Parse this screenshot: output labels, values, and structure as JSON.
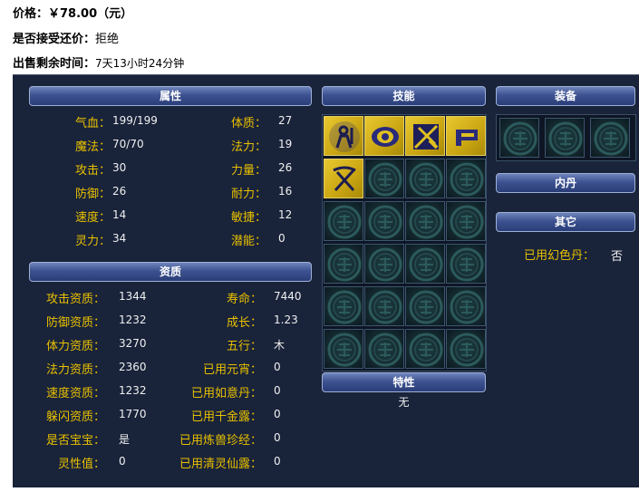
{
  "header": {
    "price_label": "价格：",
    "price_value": "￥78.00（元）",
    "bargain_label": "是否接受还价：",
    "bargain_value": "拒绝",
    "time_label": "出售剩余时间：",
    "time_value": "7天13小时24分钟"
  },
  "sections": {
    "attributes": "属性",
    "skills": "技能",
    "equipment": "装备",
    "aptitude": "资质",
    "neidan": "内丹",
    "other": "其它",
    "trait": "特性"
  },
  "attributes_left": [
    {
      "label": "气血：",
      "value": "199/199"
    },
    {
      "label": "魔法：",
      "value": "70/70"
    },
    {
      "label": "攻击：",
      "value": "30"
    },
    {
      "label": "防御：",
      "value": "26"
    },
    {
      "label": "速度：",
      "value": "14"
    },
    {
      "label": "灵力：",
      "value": "34"
    }
  ],
  "attributes_right": [
    {
      "label": "体质：",
      "value": "27"
    },
    {
      "label": "法力：",
      "value": "19"
    },
    {
      "label": "力量：",
      "value": "26"
    },
    {
      "label": "耐力：",
      "value": "16"
    },
    {
      "label": "敏捷：",
      "value": "12"
    },
    {
      "label": "潜能：",
      "value": "0"
    }
  ],
  "aptitude_left": [
    {
      "label": "攻击资质：",
      "value": "1344"
    },
    {
      "label": "防御资质：",
      "value": "1232"
    },
    {
      "label": "体力资质：",
      "value": "3270"
    },
    {
      "label": "法力资质：",
      "value": "2360"
    },
    {
      "label": "速度资质：",
      "value": "1232"
    },
    {
      "label": "躲闪资质：",
      "value": "1770"
    },
    {
      "label": "是否宝宝：",
      "value": "是"
    },
    {
      "label": "灵性值：",
      "value": "0"
    }
  ],
  "aptitude_right": [
    {
      "label": "寿命：",
      "value": "7440"
    },
    {
      "label": "成长：",
      "value": "1.23"
    },
    {
      "label": "五行：",
      "value": "木"
    },
    {
      "label": "已用元宵：",
      "value": "0"
    },
    {
      "label": "已用如意丹：",
      "value": "0"
    },
    {
      "label": "已用千金露：",
      "value": "0"
    },
    {
      "label": "已用炼兽珍经：",
      "value": "0"
    },
    {
      "label": "已用清灵仙露：",
      "value": "0"
    }
  ],
  "other": {
    "label": "已用幻色丹：",
    "value": "否"
  },
  "trait_value": "无",
  "skill_icons": [
    "skill-icon-1",
    "skill-icon-2",
    "skill-icon-3",
    "skill-icon-4",
    "skill-icon-5"
  ],
  "colors": {
    "panel_bg": "#19233a",
    "label": "#e8c000",
    "header_bg": "#3d5290",
    "skill_bg": "#e0c020"
  }
}
